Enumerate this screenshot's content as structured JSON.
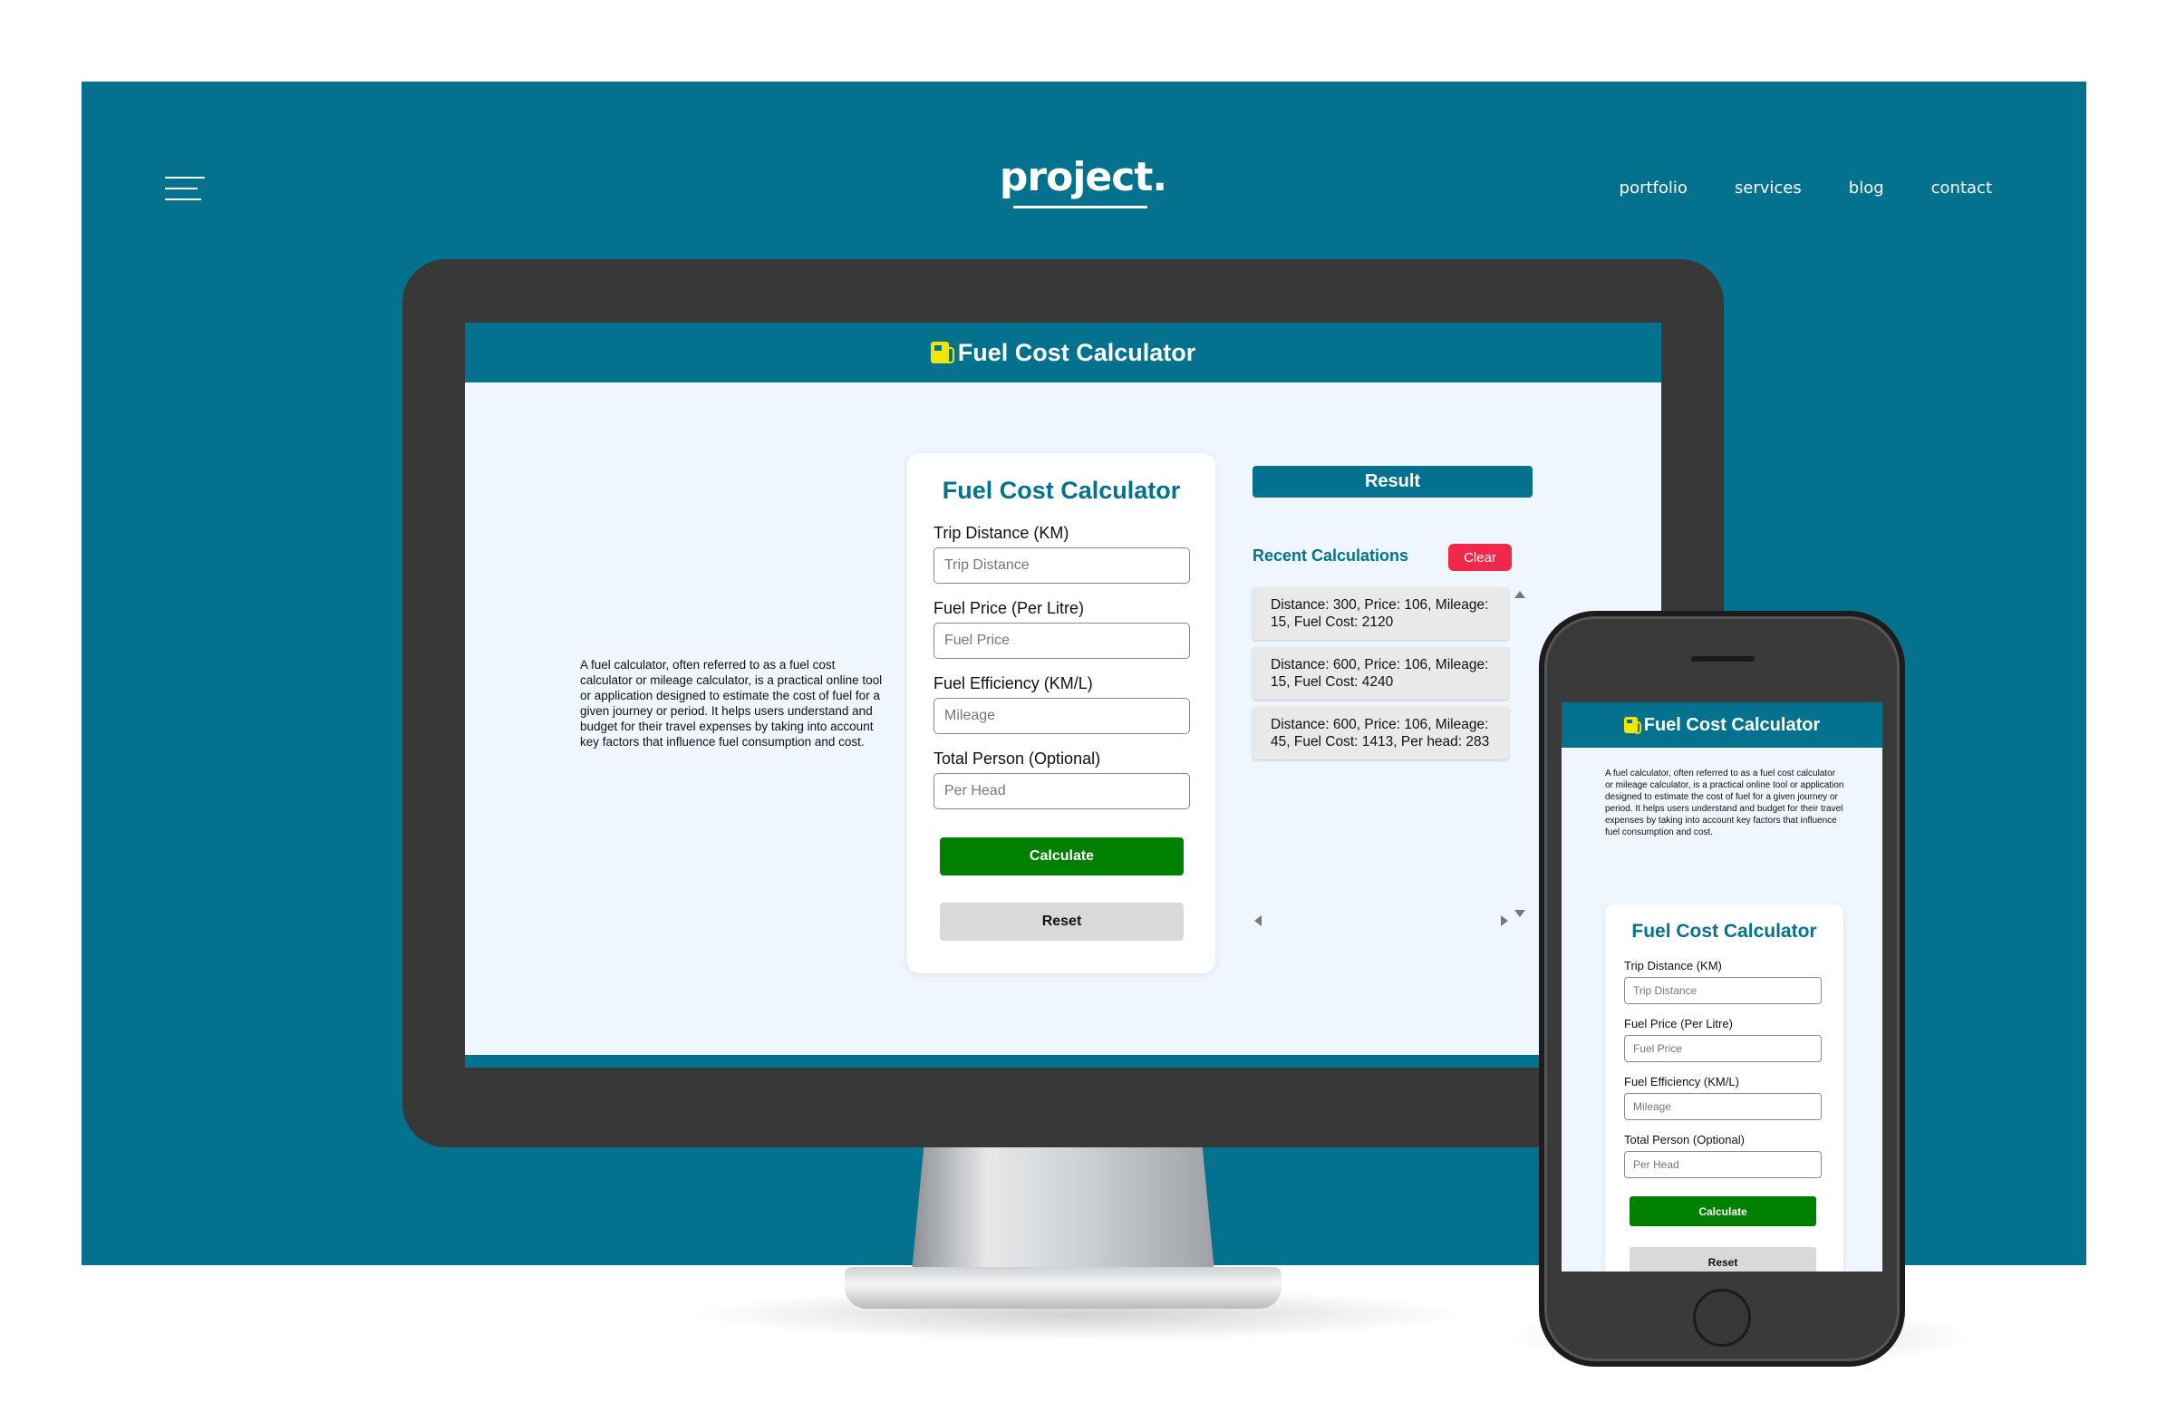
{
  "site": {
    "logo": "project.",
    "nav": [
      "portfolio",
      "services",
      "blog",
      "contact"
    ],
    "accent_color": "#04728f",
    "menu_icon": "hamburger-icon"
  },
  "app": {
    "header_title": "Fuel Cost Calculator",
    "header_icon": "fuel-pump-icon",
    "description": "A fuel calculator, often referred to as a fuel cost calculator or mileage calculator, is a practical online tool or application designed to estimate the cost of fuel for a given journey or period. It helps users understand and budget for their travel expenses by taking into account key factors that influence fuel consumption and cost.",
    "form": {
      "title": "Fuel Cost Calculator",
      "fields": [
        {
          "label": "Trip Distance (KM)",
          "placeholder": "Trip Distance",
          "value": ""
        },
        {
          "label": "Fuel Price (Per Litre)",
          "placeholder": "Fuel Price",
          "value": ""
        },
        {
          "label": "Fuel Efficiency (KM/L)",
          "placeholder": "Mileage",
          "value": ""
        },
        {
          "label": "Total Person (Optional)",
          "placeholder": "Per Head",
          "value": ""
        }
      ],
      "calculate_label": "Calculate",
      "reset_label": "Reset",
      "calculate_color": "#008000"
    },
    "result": {
      "title": "Result",
      "recent_label": "Recent Calculations",
      "clear_label": "Clear",
      "clear_color": "#f0284a",
      "history": [
        "Distance: 300, Price: 106, Mileage: 15, Fuel Cost: 2120",
        "Distance: 600, Price: 106, Mileage: 15, Fuel Cost: 4240",
        "Distance: 600, Price: 106, Mileage: 45, Fuel Cost: 1413, Per head: 283"
      ]
    }
  }
}
